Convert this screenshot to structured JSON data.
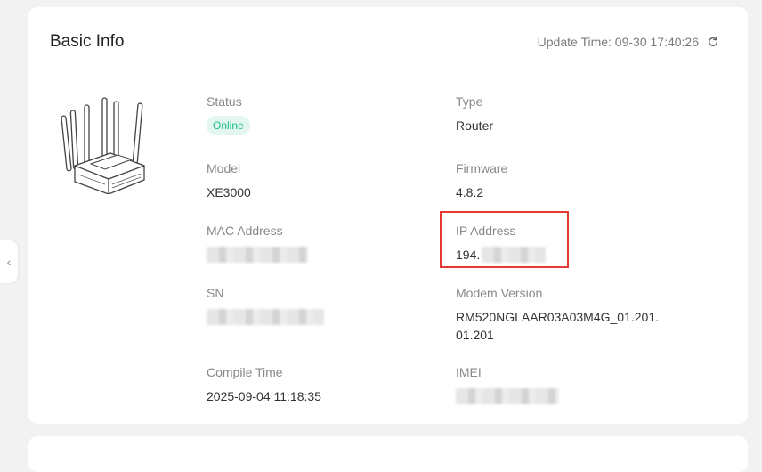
{
  "card": {
    "title": "Basic Info",
    "update_time": "Update Time: 09-30 17:40:26"
  },
  "fields": {
    "status": {
      "label": "Status",
      "value": "Online"
    },
    "type": {
      "label": "Type",
      "value": "Router"
    },
    "model": {
      "label": "Model",
      "value": "XE3000"
    },
    "firmware": {
      "label": "Firmware",
      "value": "4.8.2"
    },
    "mac": {
      "label": "MAC Address"
    },
    "ip": {
      "label": "IP Address",
      "value": "194."
    },
    "sn": {
      "label": "SN"
    },
    "modem": {
      "label": "Modem Version",
      "value": "RM520NGLAAR03A03M4G_01.201.01.201"
    },
    "compile": {
      "label": "Compile Time",
      "value": "2025-09-04 11:18:35"
    },
    "imei": {
      "label": "IMEI"
    }
  },
  "colors": {
    "online_badge_bg": "#e3f7f0",
    "online_badge_text": "#1abc85",
    "highlight_border": "#e53935"
  },
  "icons": {
    "side_toggle": "chevron-left-icon",
    "refresh": "refresh-icon",
    "device": "router-device-icon"
  }
}
